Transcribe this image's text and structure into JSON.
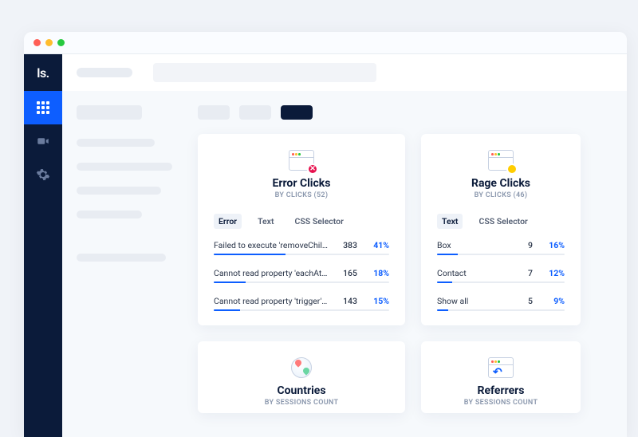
{
  "logo_text": "ls.",
  "cards": {
    "error": {
      "title": "Error Clicks",
      "sub": "BY CLICKS (52)",
      "tabs": {
        "error": "Error",
        "text": "Text",
        "css": "CSS Selector"
      },
      "rows": [
        {
          "label": "Failed to execute 'removeChild' on 'Node'…",
          "count": "383",
          "pct": "41%",
          "width": "41%"
        },
        {
          "label": "Cannot read property 'eachAttribute' of null",
          "count": "165",
          "pct": "18%",
          "width": "18%"
        },
        {
          "label": "Cannot read property 'trigger' of null",
          "count": "143",
          "pct": "15%",
          "width": "15%"
        }
      ]
    },
    "rage": {
      "title": "Rage Clicks",
      "sub": "BY CLICKS (46)",
      "tabs": {
        "text": "Text",
        "css": "CSS Selector"
      },
      "rows": [
        {
          "label": "Box",
          "count": "9",
          "pct": "16%",
          "width": "16%"
        },
        {
          "label": "Contact",
          "count": "7",
          "pct": "12%",
          "width": "12%"
        },
        {
          "label": "Show all",
          "count": "5",
          "pct": "9%",
          "width": "9%"
        }
      ]
    },
    "countries": {
      "title": "Countries",
      "sub": "BY SESSIONS COUNT"
    },
    "referrers": {
      "title": "Referrers",
      "sub": "BY SESSIONS COUNT"
    }
  }
}
